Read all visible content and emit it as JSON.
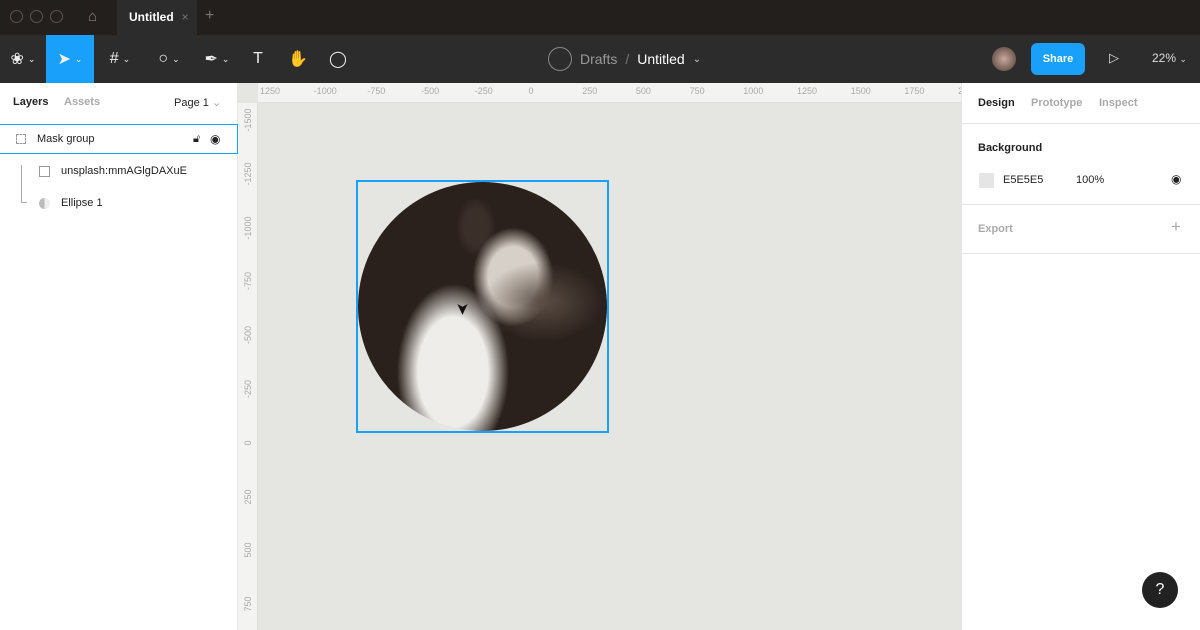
{
  "titlebar": {
    "tab": "Untitled"
  },
  "toolbar": {
    "breadcrumb_parent": "Drafts",
    "separator": "/",
    "file_name": "Untitled",
    "share": "Share",
    "zoom": "22%",
    "active_tool": "move"
  },
  "left": {
    "tabs": [
      "Layers",
      "Assets"
    ],
    "page": "Page 1",
    "layers": [
      {
        "name": "Mask group",
        "icon": "mask-group-icon",
        "selected": true
      },
      {
        "name": "unsplash:mmAGlgDAXuE",
        "icon": "image-icon"
      },
      {
        "name": "Ellipse 1",
        "icon": "ellipse-mask-icon"
      }
    ]
  },
  "rulers": {
    "top": [
      "1250",
      "-1000",
      "-750",
      "-500",
      "-250",
      "0",
      "250",
      "500",
      "750",
      "1000",
      "1250",
      "1500",
      "1750",
      "2"
    ],
    "left": [
      "-1500",
      "-1250",
      "-1000",
      "-750",
      "-500",
      "-250",
      "0",
      "250",
      "500",
      "750"
    ]
  },
  "right": {
    "tabs": [
      "Design",
      "Prototype",
      "Inspect"
    ],
    "background_label": "Background",
    "bg_hex": "E5E5E5",
    "bg_opacity": "100%",
    "export_label": "Export"
  },
  "colors": {
    "accent": "#18a0fb",
    "canvas": "#e5e5e5",
    "toolbar": "#2c2c2c"
  },
  "help": "?"
}
